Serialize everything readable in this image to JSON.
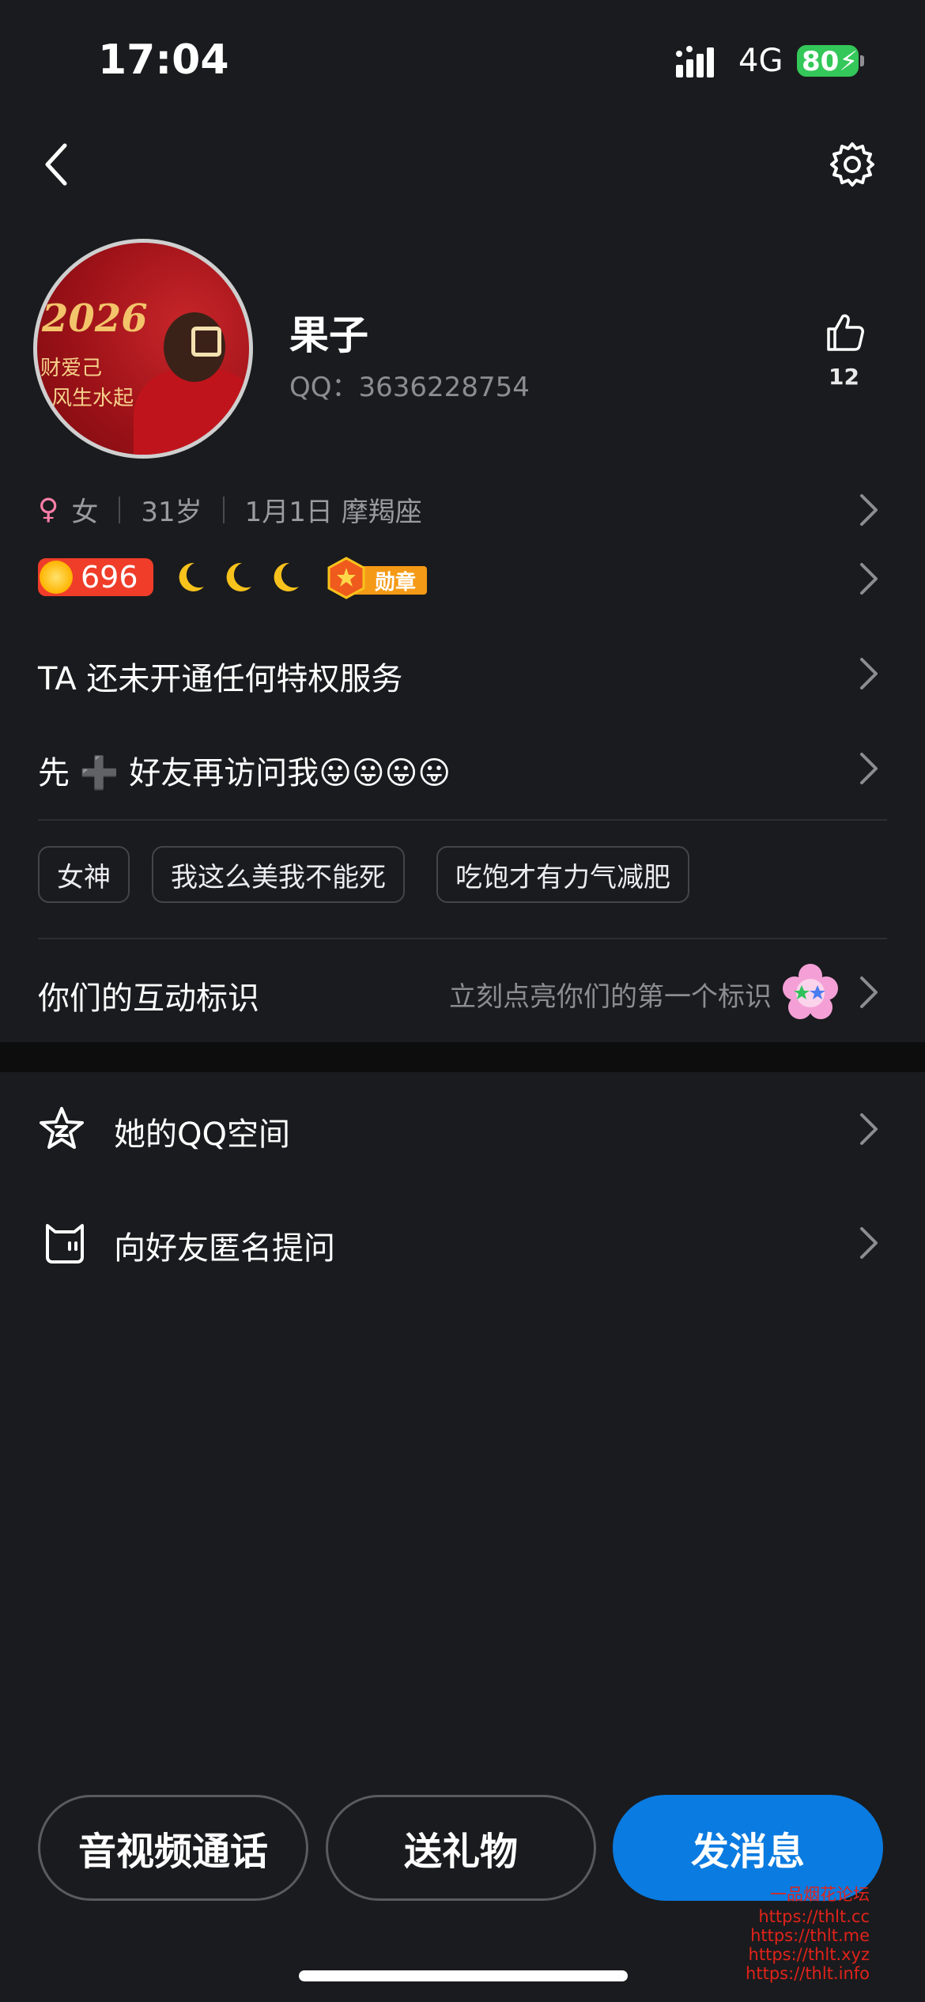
{
  "status_bar": {
    "time": "17:04",
    "network": "4G",
    "battery": "80"
  },
  "profile": {
    "avatar_text": {
      "year": "2026",
      "line1": "财爱己",
      "line2": "风生水起"
    },
    "name": "果子",
    "qq_label": "QQ：3636228754",
    "likes": "12"
  },
  "info": {
    "gender": "女",
    "age": "31岁",
    "birthday": "1月1日 摩羯座"
  },
  "level": {
    "value": "696",
    "medal_label": "勋章"
  },
  "privilege_text": "TA 还未开通任何特权服务",
  "visit_note": "先 ➕ 好友再访问我😛😛😛😛",
  "tags": [
    "女神",
    "我这么美我不能死",
    "吃饱才有力气减肥"
  ],
  "interaction": {
    "label": "你们的互动标识",
    "hint": "立刻点亮你们的第一个标识"
  },
  "list": [
    {
      "label": "她的QQ空间",
      "icon": "star-space-icon"
    },
    {
      "label": "向好友匿名提问",
      "icon": "anonymous-cat-icon"
    }
  ],
  "actions": {
    "call": "音视频通话",
    "gift": "送礼物",
    "message": "发消息"
  },
  "watermark": [
    "一品烟花论坛",
    "https://thlt.cc",
    "https://thlt.me",
    "https://thlt.xyz",
    "https://thlt.info"
  ],
  "colors": {
    "background": "#1a1b1e",
    "primary": "#0a7be0",
    "battery": "#34c759",
    "level_badge": "#ef3d2a"
  }
}
